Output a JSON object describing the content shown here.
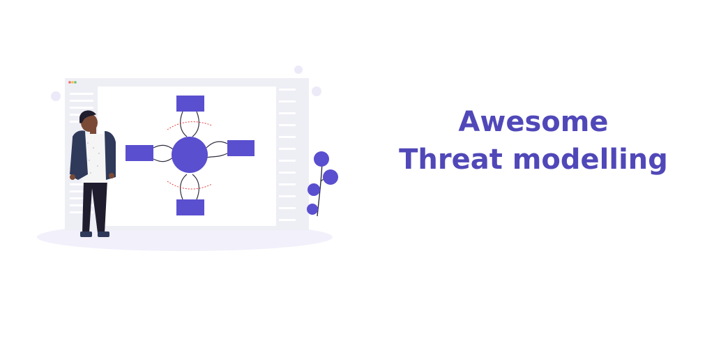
{
  "title": {
    "line1": "Awesome",
    "line2": "Threat modelling"
  },
  "colors": {
    "accent": "#5048b8",
    "diagram_shape": "#5a4fcf",
    "window_frame": "#eeeef5",
    "ground_ellipse": "#f1f0fb",
    "threat_boundary": "#e53935"
  },
  "illustration": {
    "icon": "threat-model-diagram-illustration"
  }
}
